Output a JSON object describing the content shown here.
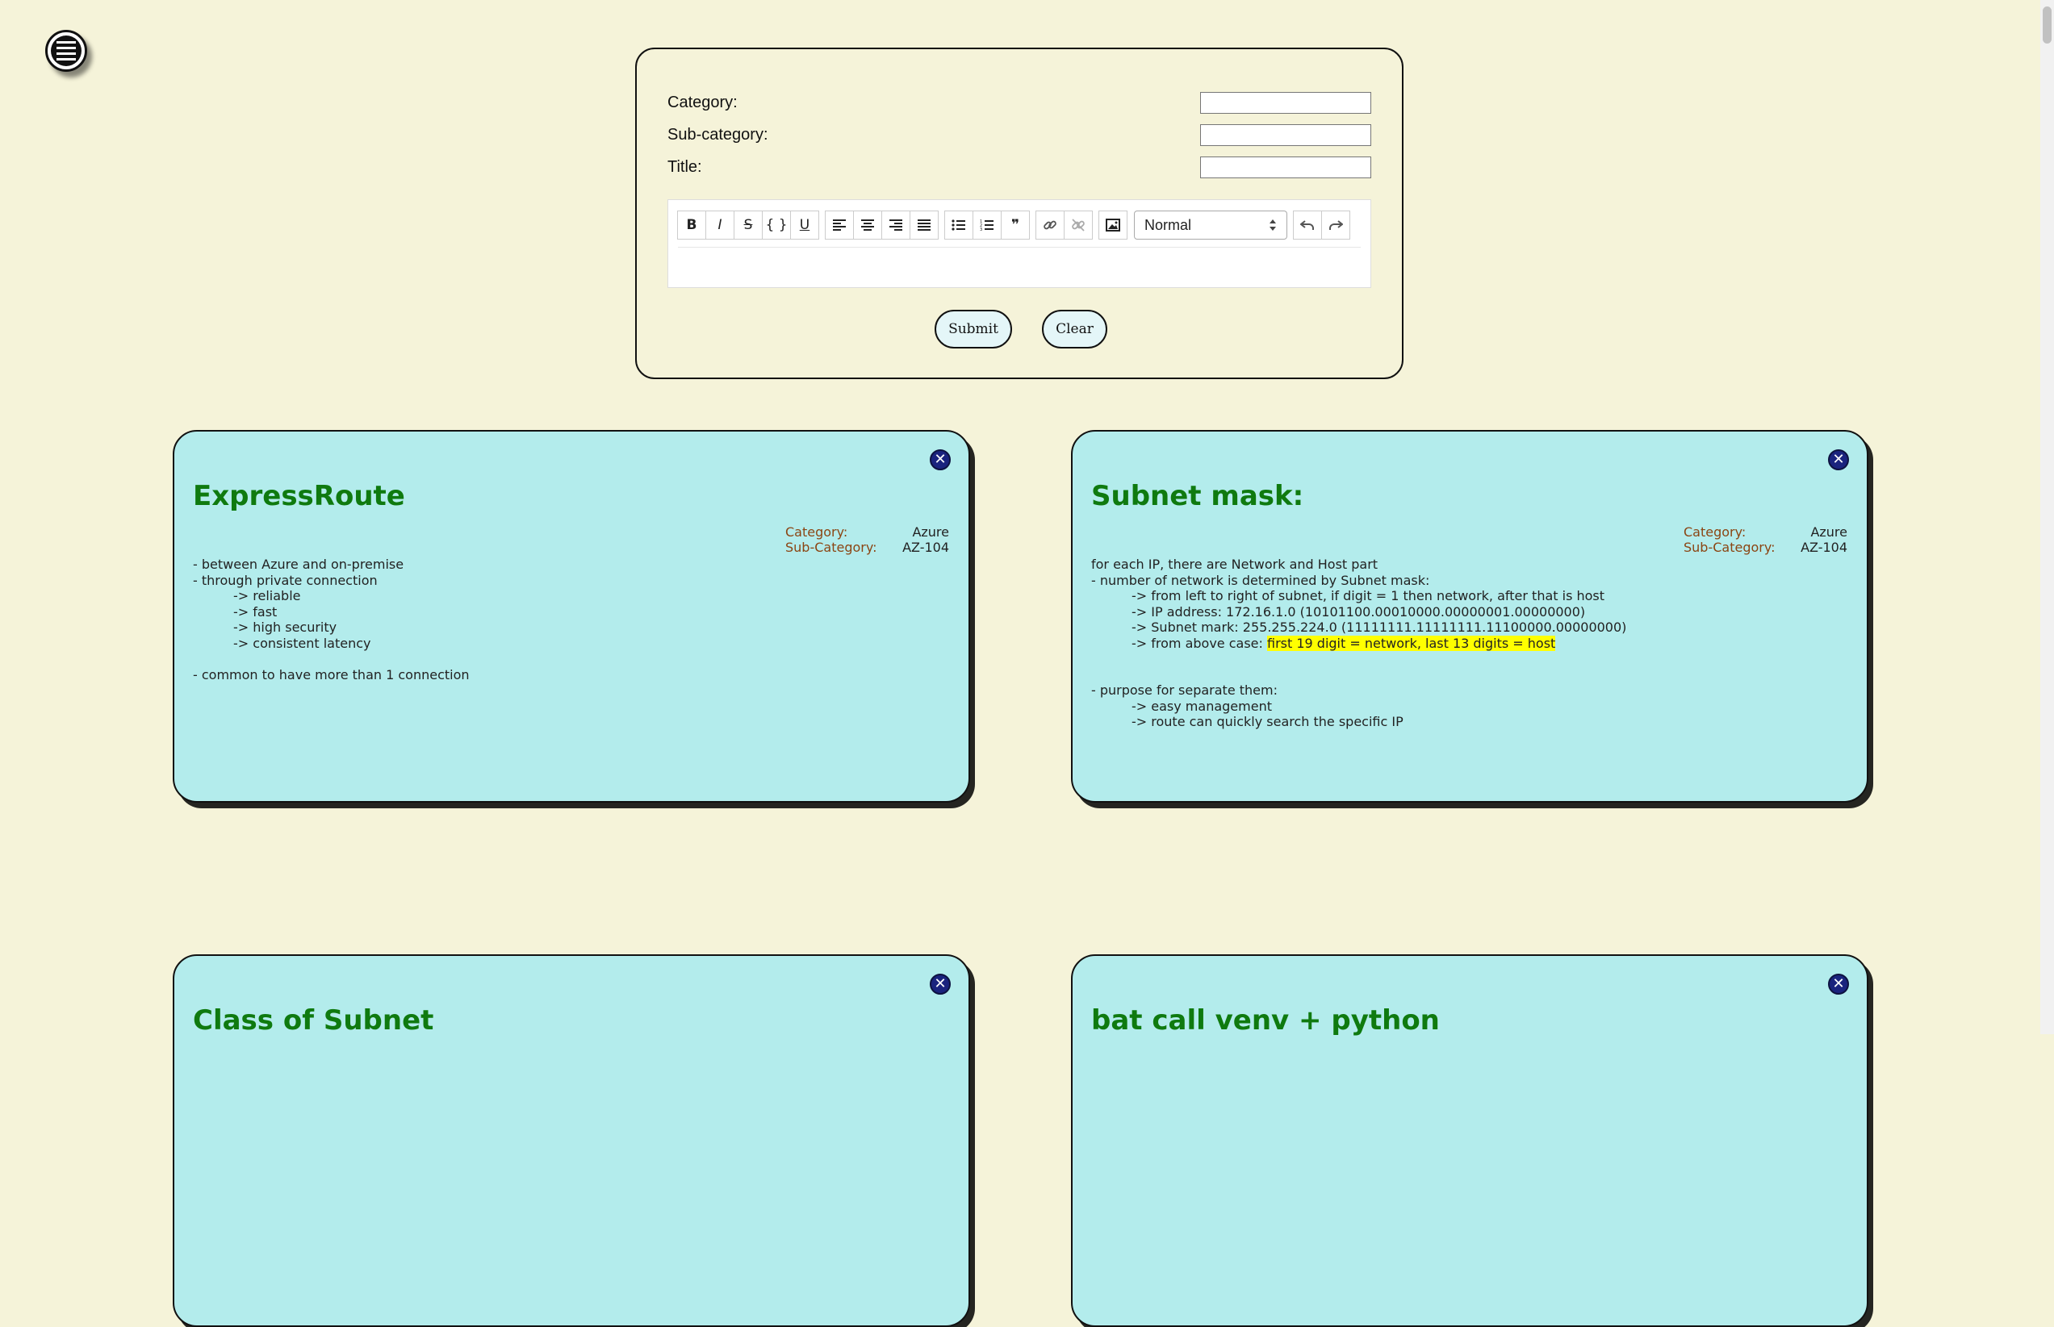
{
  "form": {
    "category_label": "Category:",
    "subcategory_label": "Sub-category:",
    "title_label": "Title:",
    "category_value": "",
    "subcategory_value": "",
    "title_value": "",
    "format_select": "Normal",
    "submit_label": "Submit",
    "clear_label": "Clear"
  },
  "toolbar": {
    "bold": "B",
    "italic": "I",
    "strike": "S",
    "code": "{ }",
    "underline": "U",
    "quote": "❞"
  },
  "cards": [
    {
      "title": "ExpressRoute",
      "category_key": "Category:",
      "category": "Azure",
      "subcategory_key": "Sub-Category:",
      "subcategory": "AZ-104",
      "lines": [
        "- between Azure and on-premise",
        "- through private connection",
        "-> reliable",
        "-> fast",
        "-> high security",
        "-> consistent latency",
        "",
        "- common to have more than 1 connection"
      ]
    },
    {
      "title": "Subnet mask:",
      "category_key": "Category:",
      "category": "Azure",
      "subcategory_key": "Sub-Category:",
      "subcategory": "AZ-104",
      "lines": [
        "for each IP, there are Network and Host part",
        "- number of network is determined by Subnet mask:",
        "-> from left to right of subnet, if digit = 1 then network, after that is host",
        "-> IP address: 172.16.1.0 (10101100.00010000.00000001.00000000)",
        "-> Subnet mark: 255.255.224.0 (11111111.11111111.11100000.00000000)",
        "-> from above case: ",
        "first 19 digit = network, last 13 digits = host",
        "",
        "- purpose for separate them:",
        "-> easy management",
        "-> route can quickly search the specific IP"
      ]
    },
    {
      "title": "Class of Subnet"
    },
    {
      "title": "bat call venv + python"
    }
  ]
}
